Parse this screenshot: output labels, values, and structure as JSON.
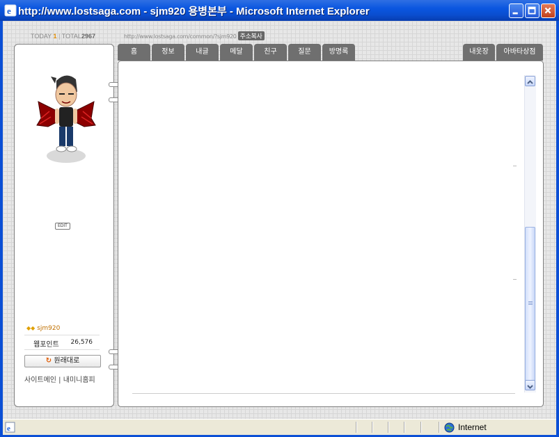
{
  "window": {
    "title": "http://www.lostsaga.com - sjm920 용병본부 - Microsoft Internet Explorer",
    "colors": {
      "titlebar": "#0a56e0",
      "close": "#c2401c"
    }
  },
  "counter": {
    "today_label": "TODAY",
    "today_value": "1",
    "total_label": "TOTAL",
    "total_value": "2967"
  },
  "urlbar": {
    "url": "http://www.lostsaga.com/common/?sjm920",
    "copy_label": "주소복사"
  },
  "tabs": [
    {
      "label": "홈"
    },
    {
      "label": "정보"
    },
    {
      "label": "내글"
    },
    {
      "label": "메달"
    },
    {
      "label": "친구"
    },
    {
      "label": "질문"
    },
    {
      "label": "방명록"
    },
    {
      "label": "내옷장"
    },
    {
      "label": "아바타상점"
    }
  ],
  "profile": {
    "edit_label": "EDIT",
    "username": "sjm920",
    "points_label": "웹포인트",
    "points_value": "26,576",
    "restore_label": "원래대로",
    "links": "사이트메인 | 내미니홈피"
  },
  "statusbar": {
    "zone": "Internet"
  }
}
